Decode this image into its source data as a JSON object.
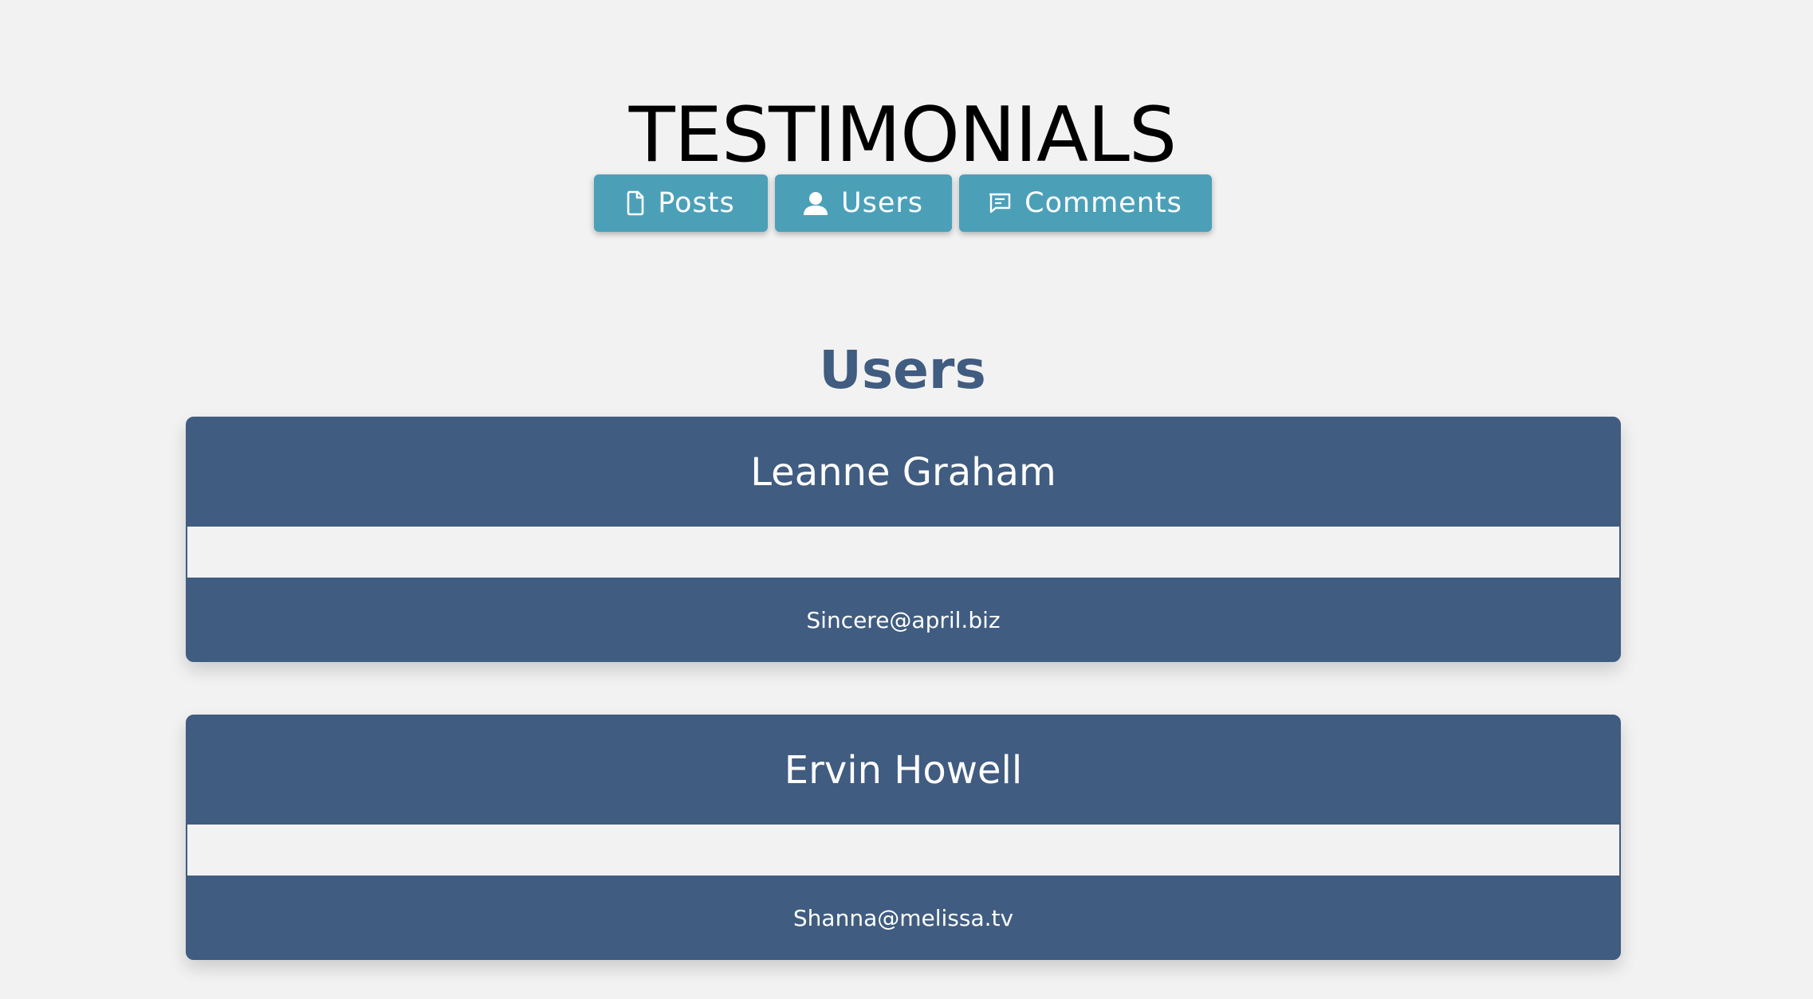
{
  "header": {
    "title": "TESTIMONIALS"
  },
  "nav": {
    "buttons": [
      {
        "label": "Posts",
        "icon": "document-icon"
      },
      {
        "label": "Users",
        "icon": "user-icon"
      },
      {
        "label": "Comments",
        "icon": "comment-icon"
      }
    ]
  },
  "section": {
    "title": "Users"
  },
  "users": [
    {
      "name": "Leanne Graham",
      "email": "Sincere@april.biz"
    },
    {
      "name": "Ervin Howell",
      "email": "Shanna@melissa.tv"
    }
  ],
  "colors": {
    "background": "#f2f2f2",
    "button": "#4ba0b8",
    "card": "#405c80",
    "section_title": "#405c80"
  }
}
